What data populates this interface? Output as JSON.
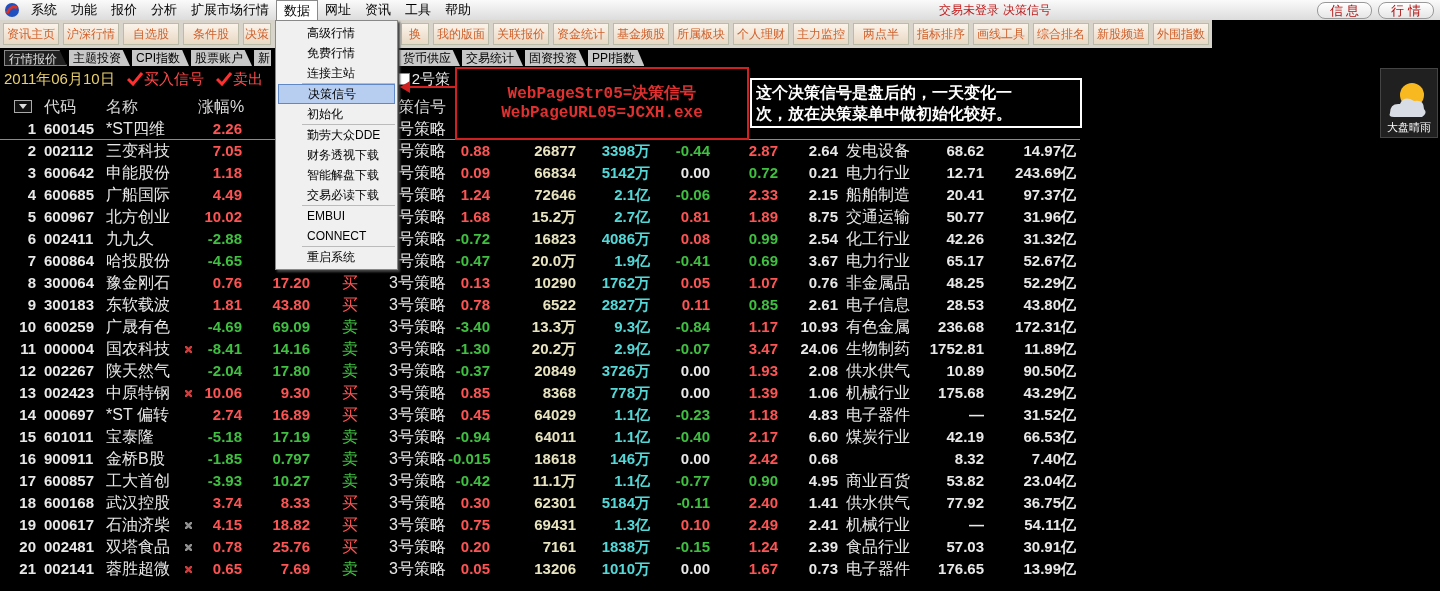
{
  "menubar": {
    "items": [
      {
        "label": "系统",
        "selected": false
      },
      {
        "label": "功能",
        "selected": false
      },
      {
        "label": "报价",
        "selected": false
      },
      {
        "label": "分析",
        "selected": false
      },
      {
        "label": "扩展市场行情",
        "selected": false
      },
      {
        "label": "数据",
        "selected": true
      },
      {
        "label": "网址",
        "selected": false
      },
      {
        "label": "资讯",
        "selected": false
      },
      {
        "label": "工具",
        "selected": false
      },
      {
        "label": "帮助",
        "selected": false
      }
    ],
    "status": "交易未登录 决策信号",
    "buttons": [
      "信 息",
      "行 情"
    ]
  },
  "toolbar": {
    "left": [
      "资讯主页",
      "沪深行情",
      "自选股",
      "条件股",
      "决策"
    ],
    "right": [
      "换",
      "我的版面",
      "关联报价",
      "资金统计",
      "基金频股",
      "所属板块",
      "个人理财",
      "主力监控",
      "两点半",
      "指标排序",
      "画线工具",
      "综合排名",
      "新股频道",
      "外围指数"
    ]
  },
  "tabs": {
    "left": [
      {
        "label": "行情报价",
        "selected": true
      },
      {
        "label": "主题投资",
        "selected": false
      },
      {
        "label": "CPI指数",
        "selected": false
      },
      {
        "label": "股票账户",
        "selected": false
      },
      {
        "label": "新",
        "selected": false
      }
    ],
    "right": [
      {
        "label": "货币供应",
        "selected": false
      },
      {
        "label": "交易统计",
        "selected": false
      },
      {
        "label": "固资投资",
        "selected": false
      },
      {
        "label": "PPI指数",
        "selected": false
      }
    ]
  },
  "filter_bar": {
    "date": "2011年06月10日",
    "signals": [
      {
        "label": "买入信号",
        "checked": true
      },
      {
        "label": "卖出",
        "checked": true
      }
    ],
    "strategy_option": {
      "label": "2号策",
      "checked": false
    }
  },
  "table": {
    "columns": {
      "code": "代码",
      "name": "名称",
      "pct": "涨幅%",
      "strategy": "策信号"
    },
    "rows": [
      {
        "no": "1",
        "code": "600145",
        "name": "*ST四维",
        "pct": "2.26",
        "strategy": "号策略",
        "selected": true
      },
      {
        "no": "2",
        "code": "002112",
        "name": "三变科技",
        "pct": "7.05",
        "strategy": "号策略",
        "chg": "0.88",
        "vol": "26877",
        "amount": "3398万",
        "speed": "-0.44",
        "ratio": "2.87",
        "turnover": "2.64",
        "industry": "发电设备",
        "pe": "68.62",
        "cap": "14.97亿",
        "selected": false
      },
      {
        "no": "3",
        "code": "600642",
        "name": "申能股份",
        "pct": "1.18",
        "strategy": "号策略",
        "chg": "0.09",
        "vol": "66834",
        "amount": "5142万",
        "speed": "0.00",
        "ratio": "0.72",
        "turnover": "0.21",
        "industry": "电力行业",
        "pe": "12.71",
        "cap": "243.69亿",
        "selected": false
      },
      {
        "no": "4",
        "code": "600685",
        "name": "广船国际",
        "pct": "4.49",
        "strategy": "号策略",
        "chg": "1.24",
        "vol": "72646",
        "amount": "2.1亿",
        "speed": "-0.06",
        "ratio": "2.33",
        "turnover": "2.15",
        "industry": "船舶制造",
        "pe": "20.41",
        "cap": "97.37亿",
        "selected": false
      },
      {
        "no": "5",
        "code": "600967",
        "name": "北方创业",
        "pct": "10.02",
        "strategy": "号策略",
        "chg": "1.68",
        "vol": "15.2万",
        "amount": "2.7亿",
        "speed": "0.81",
        "ratio": "1.89",
        "turnover": "8.75",
        "industry": "交通运输",
        "pe": "50.77",
        "cap": "31.96亿",
        "selected": false
      },
      {
        "no": "6",
        "code": "002411",
        "name": "九九久",
        "pct": "-2.88",
        "strategy": "号策略",
        "chg": "-0.72",
        "vol": "16823",
        "amount": "4086万",
        "speed": "0.08",
        "ratio": "0.99",
        "turnover": "2.54",
        "industry": "化工行业",
        "pe": "42.26",
        "cap": "31.32亿",
        "selected": false
      },
      {
        "no": "7",
        "code": "600864",
        "name": "哈投股份",
        "pct": "-4.65",
        "strategy": "号策略",
        "chg": "-0.47",
        "vol": "20.0万",
        "amount": "1.9亿",
        "speed": "-0.41",
        "ratio": "0.69",
        "turnover": "3.67",
        "industry": "电力行业",
        "pe": "65.17",
        "cap": "52.67亿",
        "selected": false
      },
      {
        "no": "8",
        "code": "300064",
        "name": "豫金刚石",
        "pct": "0.76",
        "price": "17.20",
        "signal": {
          "text": "买",
          "kind": "buy"
        },
        "strategy": "3号策略",
        "chg": "0.13",
        "vol": "10290",
        "amount": "1762万",
        "speed": "0.05",
        "ratio": "1.07",
        "turnover": "0.76",
        "industry": "非金属品",
        "pe": "48.25",
        "cap": "52.29亿",
        "selected": false
      },
      {
        "no": "9",
        "code": "300183",
        "name": "东软载波",
        "pct": "1.81",
        "price": "43.80",
        "signal": {
          "text": "买",
          "kind": "buy"
        },
        "strategy": "3号策略",
        "chg": "0.78",
        "vol": "6522",
        "amount": "2827万",
        "speed": "0.11",
        "ratio": "0.85",
        "turnover": "2.61",
        "industry": "电子信息",
        "pe": "28.53",
        "cap": "43.80亿",
        "selected": false
      },
      {
        "no": "10",
        "code": "600259",
        "name": "广晟有色",
        "pct": "-4.69",
        "price": "69.09",
        "signal": {
          "text": "卖",
          "kind": "sell"
        },
        "strategy": "3号策略",
        "chg": "-3.40",
        "vol": "13.3万",
        "amount": "9.3亿",
        "speed": "-0.84",
        "ratio": "1.17",
        "turnover": "10.93",
        "industry": "有色金属",
        "pe": "236.68",
        "cap": "172.31亿",
        "selected": false
      },
      {
        "no": "11",
        "code": "000004",
        "name": "国农科技",
        "flag": {
          "color": "#c84040"
        },
        "pct": "-8.41",
        "price": "14.16",
        "signal": {
          "text": "卖",
          "kind": "sell"
        },
        "strategy": "3号策略",
        "chg": "-1.30",
        "vol": "20.2万",
        "amount": "2.9亿",
        "speed": "-0.07",
        "ratio": "3.47",
        "turnover": "24.06",
        "industry": "生物制药",
        "pe": "1752.81",
        "cap": "11.89亿",
        "selected": false
      },
      {
        "no": "12",
        "code": "002267",
        "name": "陕天然气",
        "pct": "-2.04",
        "price": "17.80",
        "signal": {
          "text": "卖",
          "kind": "sell"
        },
        "strategy": "3号策略",
        "chg": "-0.37",
        "vol": "20849",
        "amount": "3726万",
        "speed": "0.00",
        "ratio": "1.93",
        "turnover": "2.08",
        "industry": "供水供气",
        "pe": "10.89",
        "cap": "90.50亿",
        "selected": false
      },
      {
        "no": "13",
        "code": "002423",
        "name": "中原特钢",
        "flag": {
          "color": "#c84040"
        },
        "pct": "10.06",
        "price": "9.30",
        "signal": {
          "text": "买",
          "kind": "buy"
        },
        "strategy": "3号策略",
        "chg": "0.85",
        "vol": "8368",
        "amount": "778万",
        "speed": "0.00",
        "ratio": "1.39",
        "turnover": "1.06",
        "industry": "机械行业",
        "pe": "175.68",
        "cap": "43.29亿",
        "selected": false
      },
      {
        "no": "14",
        "code": "000697",
        "name": "*ST 偏转",
        "pct": "2.74",
        "price": "16.89",
        "signal": {
          "text": "买",
          "kind": "buy"
        },
        "strategy": "3号策略",
        "chg": "0.45",
        "vol": "64029",
        "amount": "1.1亿",
        "speed": "-0.23",
        "ratio": "1.18",
        "turnover": "4.83",
        "industry": "电子器件",
        "pe": "—",
        "cap": "31.52亿",
        "selected": false
      },
      {
        "no": "15",
        "code": "601011",
        "name": "宝泰隆",
        "pct": "-5.18",
        "price": "17.19",
        "signal": {
          "text": "卖",
          "kind": "sell"
        },
        "strategy": "3号策略",
        "chg": "-0.94",
        "vol": "64011",
        "amount": "1.1亿",
        "speed": "-0.40",
        "ratio": "2.17",
        "turnover": "6.60",
        "industry": "煤炭行业",
        "pe": "42.19",
        "cap": "66.53亿",
        "selected": false
      },
      {
        "no": "16",
        "code": "900911",
        "name": "金桥B股",
        "pct": "-1.85",
        "price": "0.797",
        "signal": {
          "text": "卖",
          "kind": "sell"
        },
        "strategy": "3号策略",
        "chg": "-0.015",
        "vol": "18618",
        "amount": "146万",
        "speed": "0.00",
        "ratio": "2.42",
        "turnover": "0.68",
        "pe": "8.32",
        "cap": "7.40亿",
        "selected": false
      },
      {
        "no": "17",
        "code": "600857",
        "name": "工大首创",
        "pct": "-3.93",
        "price": "10.27",
        "signal": {
          "text": "卖",
          "kind": "sell"
        },
        "strategy": "3号策略",
        "chg": "-0.42",
        "vol": "11.1万",
        "amount": "1.1亿",
        "speed": "-0.77",
        "ratio": "0.90",
        "turnover": "4.95",
        "industry": "商业百货",
        "pe": "53.82",
        "cap": "23.04亿",
        "selected": false
      },
      {
        "no": "18",
        "code": "600168",
        "name": "武汉控股",
        "pct": "3.74",
        "price": "8.33",
        "signal": {
          "text": "买",
          "kind": "buy"
        },
        "strategy": "3号策略",
        "chg": "0.30",
        "vol": "62301",
        "amount": "5184万",
        "speed": "-0.11",
        "ratio": "2.40",
        "turnover": "1.41",
        "industry": "供水供气",
        "pe": "77.92",
        "cap": "36.75亿",
        "selected": false
      },
      {
        "no": "19",
        "code": "000617",
        "name": "石油济柴",
        "flag": {
          "color": "#909090"
        },
        "pct": "4.15",
        "price": "18.82",
        "signal": {
          "text": "买",
          "kind": "buy"
        },
        "strategy": "3号策略",
        "chg": "0.75",
        "vol": "69431",
        "amount": "1.3亿",
        "speed": "0.10",
        "ratio": "2.49",
        "turnover": "2.41",
        "industry": "机械行业",
        "pe": "—",
        "cap": "54.11亿",
        "selected": false
      },
      {
        "no": "20",
        "code": "002481",
        "name": "双塔食品",
        "flag": {
          "color": "#909090"
        },
        "pct": "0.78",
        "price": "25.76",
        "signal": {
          "text": "买",
          "kind": "buy"
        },
        "strategy": "3号策略",
        "chg": "0.20",
        "vol": "7161",
        "amount": "1838万",
        "speed": "-0.15",
        "ratio": "1.24",
        "turnover": "2.39",
        "industry": "食品行业",
        "pe": "57.03",
        "cap": "30.91亿",
        "selected": false
      },
      {
        "no": "21",
        "code": "002141",
        "name": "蓉胜超微",
        "flag": {
          "color": "#c84040"
        },
        "pct": "0.65",
        "price": "7.69",
        "signal": {
          "text": "卖",
          "kind": "sell"
        },
        "strategy": "3号策略",
        "chg": "0.05",
        "vol": "13206",
        "amount": "1010万",
        "speed": "0.00",
        "ratio": "1.67",
        "turnover": "0.73",
        "industry": "电子器件",
        "pe": "176.65",
        "cap": "13.99亿",
        "selected": false
      }
    ]
  },
  "dropdown_menu": {
    "groups": [
      [
        {
          "label": "高级行情",
          "selected": false
        },
        {
          "label": "免费行情",
          "selected": false
        },
        {
          "label": "连接主站",
          "selected": false
        }
      ],
      [
        {
          "label": "决策信号",
          "selected": true
        },
        {
          "label": "初始化",
          "selected": false
        }
      ],
      [
        {
          "label": "勤劳大众DDE",
          "selected": false
        },
        {
          "label": "财务透视下载",
          "selected": false
        },
        {
          "label": "智能解盘下载",
          "selected": false
        },
        {
          "label": "交易必读下载",
          "selected": false
        }
      ],
      [
        {
          "label": "EMBUI",
          "selected": false
        },
        {
          "label": "CONNECT",
          "selected": false
        }
      ],
      [
        {
          "label": "重启系统",
          "selected": false
        }
      ]
    ]
  },
  "annotation": {
    "lines": [
      "WebPageStr05=决策信号",
      "WebPageURL05=JCXH.exe"
    ]
  },
  "callout": {
    "text": "这个决策信号是盘后的，一天变化一次，放在决策菜单中做初始化较好。"
  },
  "weather_widget": {
    "label": "大盘晴雨"
  }
}
